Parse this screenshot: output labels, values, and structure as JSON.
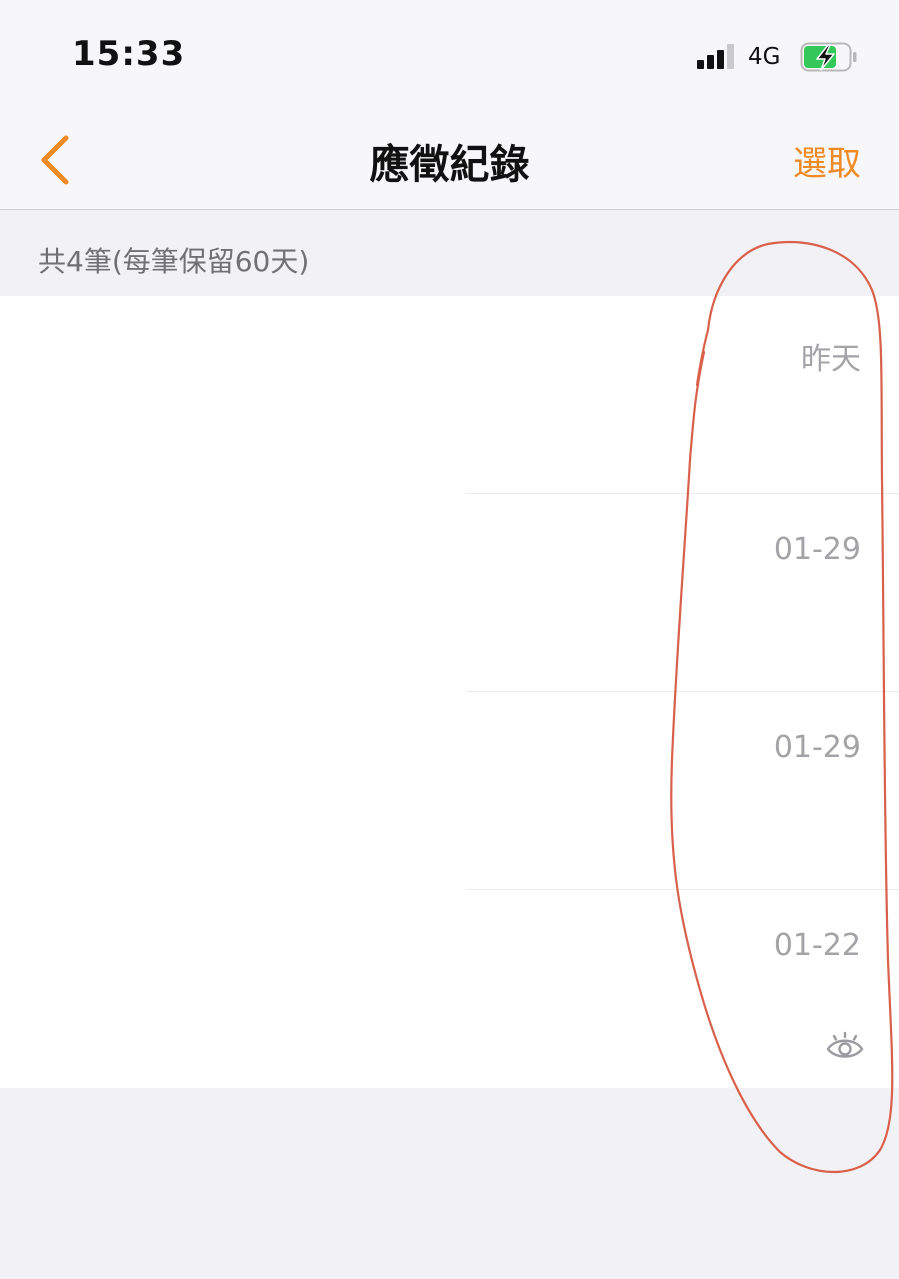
{
  "status_bar": {
    "time": "15:33",
    "network": "4G",
    "icons": [
      "signal-icon",
      "battery-charging-icon"
    ]
  },
  "nav": {
    "title": "應徵紀錄",
    "select_label": "選取",
    "back_icon": "chevron-left-icon"
  },
  "summary": "共4筆(每筆保留60天)",
  "records": [
    {
      "date": "昨天"
    },
    {
      "date": "01-29"
    },
    {
      "date": "01-29"
    },
    {
      "date": "01-22",
      "icon": "eye-icon"
    }
  ],
  "colors": {
    "accent": "#f08a24",
    "annotation": "#d9604a",
    "battery": "#34c759"
  }
}
